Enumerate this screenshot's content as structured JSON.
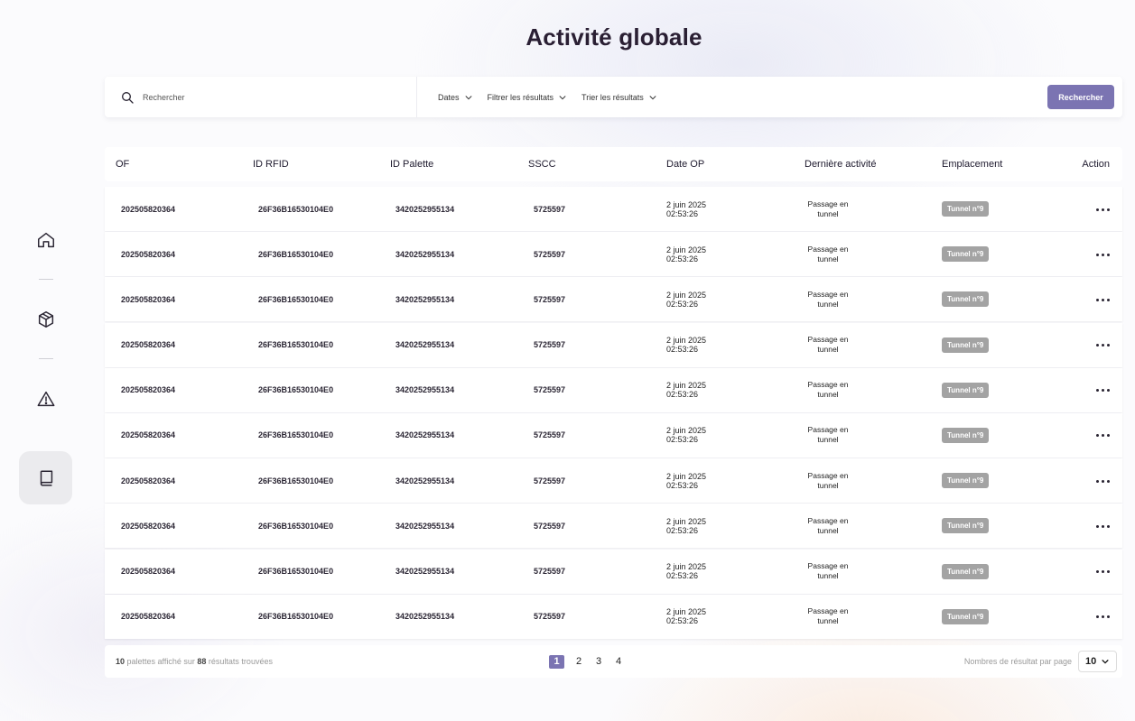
{
  "page_title": "Activité globale",
  "sidebar": {
    "items": [
      {
        "icon": "home-icon",
        "active": false
      },
      {
        "icon": "box-icon",
        "active": false
      },
      {
        "icon": "warning-icon",
        "active": false
      },
      {
        "icon": "book-icon",
        "active": true
      }
    ]
  },
  "toolbar": {
    "search_placeholder": "Rechercher",
    "filters": [
      "Dates",
      "Filtrer les résultats",
      "Trier les résultats"
    ],
    "search_button": "Rechercher"
  },
  "table": {
    "columns": [
      "OF",
      "ID RFID",
      "ID Palette",
      "SSCC",
      "Date OP",
      "Dernière activité",
      "Emplacement",
      "Action"
    ],
    "rows": [
      {
        "of": "202505820364",
        "rfid": "26F36B16530104E0",
        "palette": "3420252955134",
        "sscc": "5725597",
        "date": "2 juin 2025",
        "time": "02:53:26",
        "activity_1": "Passage en",
        "activity_2": "tunnel",
        "location": "Tunnel n°9"
      },
      {
        "of": "202505820364",
        "rfid": "26F36B16530104E0",
        "palette": "3420252955134",
        "sscc": "5725597",
        "date": "2 juin 2025",
        "time": "02:53:26",
        "activity_1": "Passage en",
        "activity_2": "tunnel",
        "location": "Tunnel n°9"
      },
      {
        "of": "202505820364",
        "rfid": "26F36B16530104E0",
        "palette": "3420252955134",
        "sscc": "5725597",
        "date": "2 juin 2025",
        "time": "02:53:26",
        "activity_1": "Passage en",
        "activity_2": "tunnel",
        "location": "Tunnel n°9"
      },
      {
        "of": "202505820364",
        "rfid": "26F36B16530104E0",
        "palette": "3420252955134",
        "sscc": "5725597",
        "date": "2 juin 2025",
        "time": "02:53:26",
        "activity_1": "Passage en",
        "activity_2": "tunnel",
        "location": "Tunnel n°9"
      },
      {
        "of": "202505820364",
        "rfid": "26F36B16530104E0",
        "palette": "3420252955134",
        "sscc": "5725597",
        "date": "2 juin 2025",
        "time": "02:53:26",
        "activity_1": "Passage en",
        "activity_2": "tunnel",
        "location": "Tunnel n°9"
      },
      {
        "of": "202505820364",
        "rfid": "26F36B16530104E0",
        "palette": "3420252955134",
        "sscc": "5725597",
        "date": "2 juin 2025",
        "time": "02:53:26",
        "activity_1": "Passage en",
        "activity_2": "tunnel",
        "location": "Tunnel n°9"
      },
      {
        "of": "202505820364",
        "rfid": "26F36B16530104E0",
        "palette": "3420252955134",
        "sscc": "5725597",
        "date": "2 juin 2025",
        "time": "02:53:26",
        "activity_1": "Passage en",
        "activity_2": "tunnel",
        "location": "Tunnel n°9"
      },
      {
        "of": "202505820364",
        "rfid": "26F36B16530104E0",
        "palette": "3420252955134",
        "sscc": "5725597",
        "date": "2 juin 2025",
        "time": "02:53:26",
        "activity_1": "Passage en",
        "activity_2": "tunnel",
        "location": "Tunnel n°9"
      },
      {
        "of": "202505820364",
        "rfid": "26F36B16530104E0",
        "palette": "3420252955134",
        "sscc": "5725597",
        "date": "2 juin 2025",
        "time": "02:53:26",
        "activity_1": "Passage en",
        "activity_2": "tunnel",
        "location": "Tunnel n°9"
      },
      {
        "of": "202505820364",
        "rfid": "26F36B16530104E0",
        "palette": "3420252955134",
        "sscc": "5725597",
        "date": "2 juin 2025",
        "time": "02:53:26",
        "activity_1": "Passage en",
        "activity_2": "tunnel",
        "location": "Tunnel n°9"
      }
    ]
  },
  "footer": {
    "shown_count": "10",
    "shown_text": " palettes affiché sur ",
    "total_count": "88",
    "total_text": " résultats trouvées",
    "pages": [
      "1",
      "2",
      "3",
      "4"
    ],
    "current_page": "1",
    "per_page_label": "Nombres de résultat par page",
    "per_page_value": "10"
  },
  "colors": {
    "accent": "#7b74b2",
    "badge": "#a3a3a3",
    "title": "#2a1f33"
  }
}
